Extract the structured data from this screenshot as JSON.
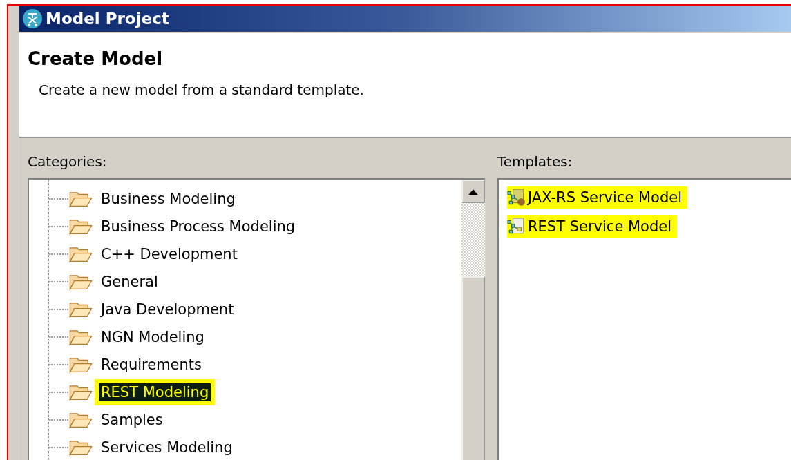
{
  "window": {
    "title": "Model Project"
  },
  "header": {
    "title": "Create Model",
    "description": "Create a new model from a standard template."
  },
  "categories": {
    "label": "Categories:",
    "items": [
      {
        "label": "Business Modeling",
        "selected": false,
        "highlighted": false
      },
      {
        "label": "Business Process Modeling",
        "selected": false,
        "highlighted": false
      },
      {
        "label": "C++ Development",
        "selected": false,
        "highlighted": false
      },
      {
        "label": "General",
        "selected": false,
        "highlighted": false
      },
      {
        "label": "Java Development",
        "selected": false,
        "highlighted": false
      },
      {
        "label": "NGN Modeling",
        "selected": false,
        "highlighted": false
      },
      {
        "label": "Requirements",
        "selected": false,
        "highlighted": false
      },
      {
        "label": "REST Modeling",
        "selected": true,
        "highlighted": true
      },
      {
        "label": "Samples",
        "selected": false,
        "highlighted": false
      },
      {
        "label": "Services Modeling",
        "selected": false,
        "highlighted": false
      }
    ]
  },
  "templates": {
    "label": "Templates:",
    "items": [
      {
        "label": "JAX-RS Service Model",
        "kind": "jaxrs",
        "selected": false,
        "highlighted": true
      },
      {
        "label": "REST Service Model",
        "kind": "rest",
        "selected": false,
        "highlighted": true
      }
    ]
  }
}
